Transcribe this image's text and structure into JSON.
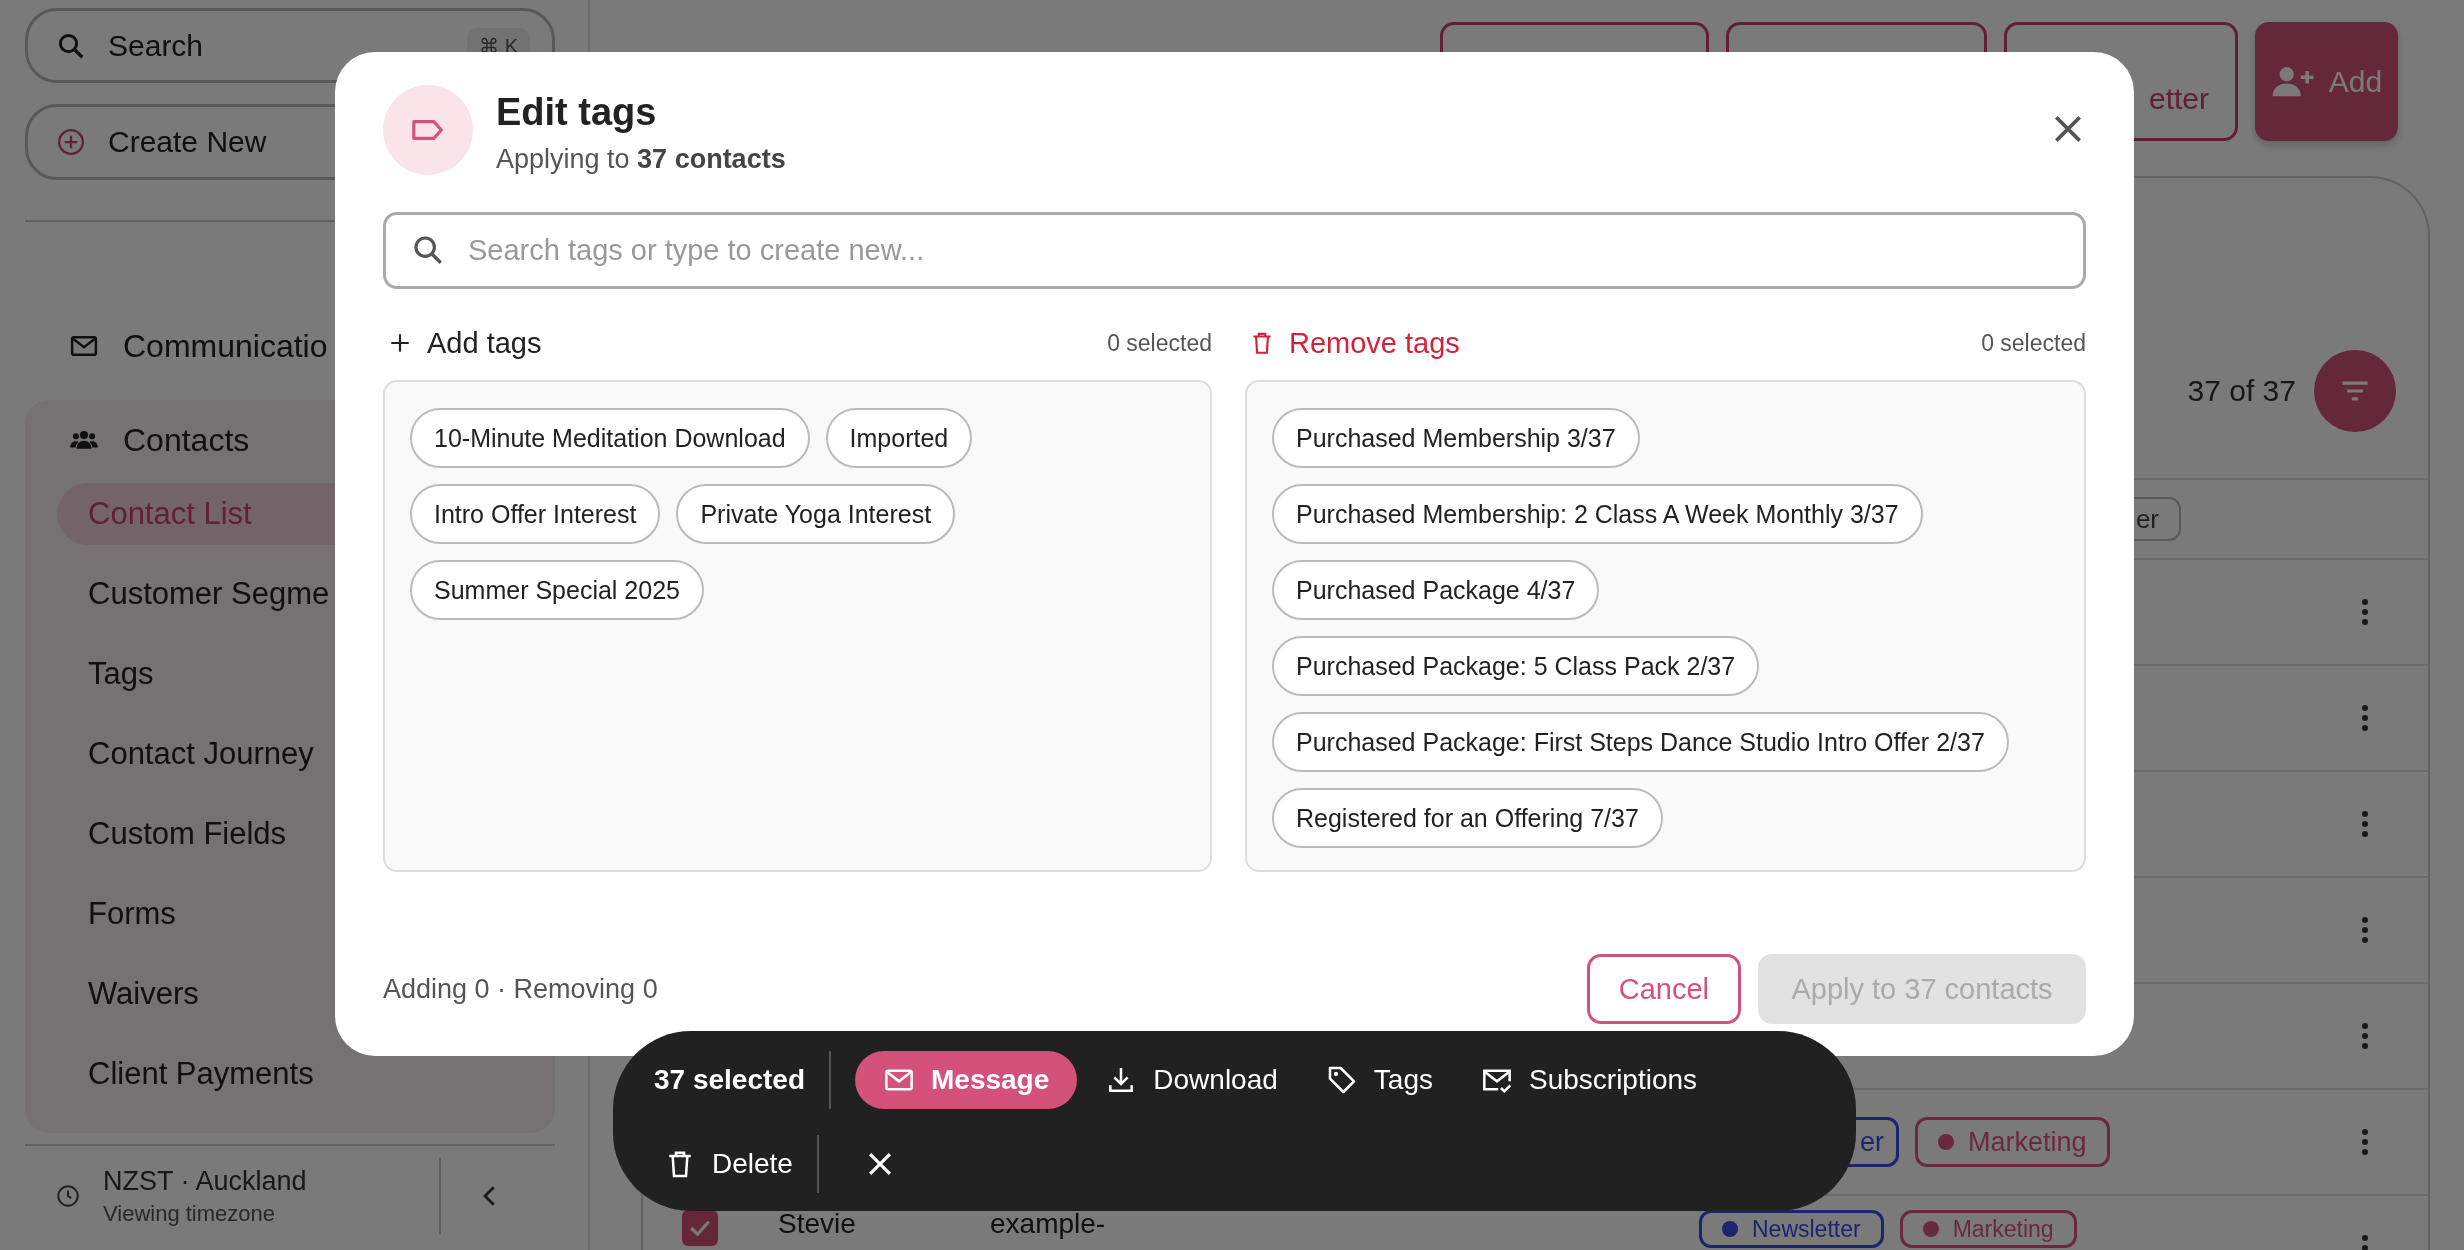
{
  "sidebar": {
    "search": {
      "placeholder": "Search",
      "shortcut": "⌘ K"
    },
    "create_button": "Create New",
    "nav": [
      {
        "label": "Communicatio",
        "kind": "mail"
      }
    ],
    "group": {
      "label": "Contacts",
      "items": [
        {
          "label": "Contact List",
          "selected": true
        },
        {
          "label": "Customer Segme",
          "selected": false
        },
        {
          "label": "Tags",
          "selected": false
        },
        {
          "label": "Contact Journey",
          "selected": false
        },
        {
          "label": "Custom Fields",
          "selected": false
        },
        {
          "label": "Forms",
          "selected": false
        },
        {
          "label": "Waivers",
          "selected": false
        },
        {
          "label": "Client Payments",
          "selected": false
        }
      ]
    },
    "footer": {
      "timezone": "NZST · Auckland",
      "caption": "Viewing timezone"
    }
  },
  "header": {
    "buttons": [
      {
        "kind": "outline"
      },
      {
        "kind": "outline"
      },
      {
        "kind": "outline",
        "label": "etter"
      },
      {
        "kind": "primary",
        "label": "Add"
      }
    ]
  },
  "results": {
    "count": "37 of 37"
  },
  "column_chip": {
    "label": "er"
  },
  "rows": [
    {
      "kind": "covered"
    },
    {
      "kind": "covered"
    },
    {
      "kind": "covered"
    },
    {
      "kind": "covered"
    },
    {
      "kind": "covered"
    },
    {
      "kind": "partial",
      "tags": [
        {
          "label": "er",
          "color": "#1c2470",
          "cut": true
        },
        {
          "label": "Marketing",
          "color": "#6a2a3d",
          "cut": false
        }
      ]
    },
    {
      "kind": "full",
      "checked": true,
      "name": "Stevie",
      "email": "example-",
      "tags": [
        {
          "label": "Newsletter",
          "color": "#1c2470",
          "cut": false
        },
        {
          "label": "Marketing",
          "color": "#6a2a3d",
          "cut": false
        }
      ]
    }
  ],
  "modal": {
    "title": "Edit tags",
    "subtitle": "Applying to **37 contacts**",
    "search": {
      "placeholder": "Search tags or type to create new..."
    },
    "add": {
      "title": "Add tags",
      "count": "0 selected",
      "tags": [
        {
          "label": "10-Minute Meditation Download",
          "selected": false
        },
        {
          "label": "Imported",
          "selected": false
        },
        {
          "label": "Intro Offer Interest",
          "selected": false
        },
        {
          "label": "Private Yoga Interest",
          "selected": false
        },
        {
          "label": "Summer Special 2025",
          "selected": false
        }
      ]
    },
    "remove": {
      "title": "Remove tags",
      "count": "0 selected",
      "tags": [
        {
          "label": "Purchased Membership 3/37",
          "selected": false
        },
        {
          "label": "Purchased Membership: 2 Class A Week Monthly 3/37",
          "selected": false
        },
        {
          "label": "Purchased Package 4/37",
          "selected": false
        },
        {
          "label": "Purchased Package: 5 Class Pack 2/37",
          "selected": false
        },
        {
          "label": "Purchased Package: First Steps Dance Studio Intro Offer 2/37",
          "selected": false
        },
        {
          "label": "Registered for an Offering 7/37",
          "selected": false
        }
      ]
    },
    "summary": "Adding 0 · Removing 0",
    "cancel": "Cancel",
    "apply": {
      "label": "Apply to 37 contacts",
      "disabled": true
    }
  },
  "bulk_bar": {
    "count": "37 selected",
    "actions": [
      {
        "label": "Message",
        "kind": "mail",
        "primary": true
      },
      {
        "label": "Download",
        "kind": "download",
        "primary": false
      },
      {
        "label": "Tags",
        "kind": "tag",
        "primary": false
      },
      {
        "label": "Subscriptions",
        "kind": "mailcheck",
        "primary": false
      }
    ],
    "delete": "Delete"
  }
}
